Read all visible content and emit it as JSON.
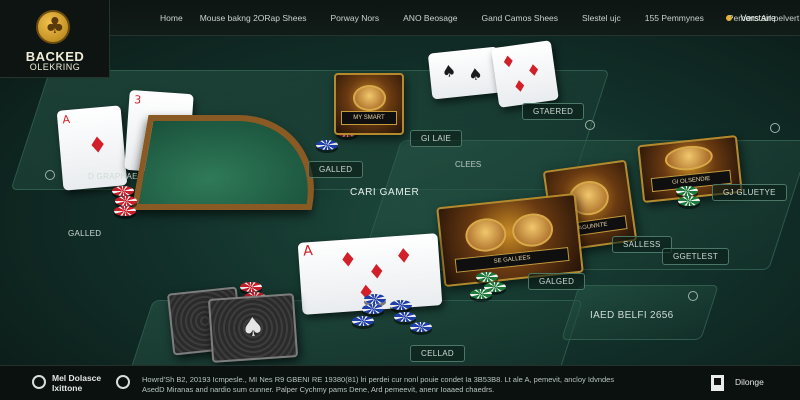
{
  "logo": {
    "line1": "BACKED",
    "line2": "OLEKRING"
  },
  "nav": {
    "items": [
      "Home",
      "Mouse bakng 2ORap Shees",
      "Porway Nors",
      "ANO Beosage",
      "Gand Camos Shees",
      "Slestel ujc",
      "155 Pemmynes",
      "Pemons Ari pelvert"
    ],
    "right_label": "Verstaire"
  },
  "panels": {
    "top_left_label": "D GRAPHAER",
    "top_left_pill": "GALLED",
    "top_mid_pill": "GALLED",
    "art1_banner": "MY SMART",
    "art1_pill": "GI LAIE",
    "cards_pill": "GTAERED",
    "center_title": "CARI GAMER",
    "center_sub": "CLEES",
    "right_art_banner": "GI OLSENDIE",
    "right_art_pill": "GJ GLUETYE",
    "mid_art_banner": "AGUNNTE",
    "mid_art_pill": "SALLESS",
    "right_pill": "GGETLEST",
    "mid_chips_label": "GALGED",
    "mid_card_banner": "SE GALLEES",
    "bottom_pill": "CELLAD",
    "bottom_label": "IAED BELFI 2656",
    "dark_card_pill": "GALLED"
  },
  "cards": {
    "ace": {
      "rank": "A",
      "suit": "♦"
    },
    "three": {
      "rank": "3",
      "suit": "♥"
    },
    "spades": {
      "rank": "",
      "suit": "♠"
    },
    "center_ace": {
      "rank": "A",
      "suit": "♦"
    },
    "dark_card": {
      "suit": "♠"
    }
  },
  "bottombar": {
    "left_line1": "Mel Dolasce",
    "left_line2": "Ixittone",
    "mid_line1": "Howrd'Sh B2, 20193 Icmpesle., MI Nes R9 GBENI RE 19380(81) lri perdei cur nonl pouie condet Ia 3B53B8. Lt ale A, pemevit, ancloy Idvndes",
    "mid_line2": "AsedD Miranas and nardio sum cunner.                    Palper Cychmy pams Dene, Ard pemeevit, anenr Ioaaed chaedrs.",
    "right_label": "Dilonge"
  },
  "colors": {
    "accent": "#e3b23c",
    "felt": "#1d4a3c",
    "bar": "#0e1512"
  }
}
